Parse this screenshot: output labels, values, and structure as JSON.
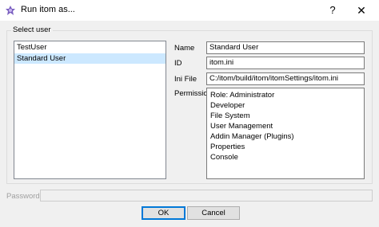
{
  "window": {
    "title": "Run itom as...",
    "help_glyph": "?",
    "close_glyph": "✕"
  },
  "group": {
    "label": "Select user"
  },
  "users": [
    "TestUser",
    "Standard User"
  ],
  "selected_user_index": 1,
  "details": {
    "name_label": "Name",
    "name_value": "Standard User",
    "id_label": "ID",
    "id_value": "itom.ini",
    "ini_label": "Ini File",
    "ini_value": "C:/itom/build/itom/itomSettings/itom.ini",
    "permission_label": "Permission",
    "permissions": [
      "Role: Administrator",
      "Developer",
      "File System",
      "User Management",
      "Addin Manager (Plugins)",
      "Properties",
      "Console"
    ]
  },
  "password": {
    "label": "Password",
    "value": ""
  },
  "buttons": {
    "ok": "OK",
    "cancel": "Cancel"
  }
}
